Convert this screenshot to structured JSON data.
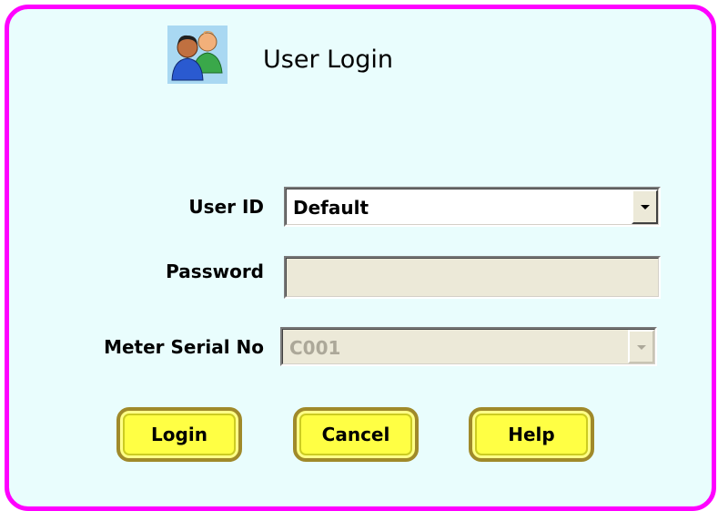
{
  "dialog": {
    "title": "User Login",
    "icon": "users-icon"
  },
  "form": {
    "user_id": {
      "label": "User ID",
      "value": "Default"
    },
    "password": {
      "label": "Password",
      "value": ""
    },
    "meter_serial": {
      "label": "Meter Serial No",
      "value": "C001"
    }
  },
  "buttons": {
    "login": "Login",
    "cancel": "Cancel",
    "help": "Help"
  },
  "colors": {
    "border": "#ff00ff",
    "background": "#e9fdfd",
    "button": "#ffff44",
    "disabled_field": "#ece9d8"
  }
}
